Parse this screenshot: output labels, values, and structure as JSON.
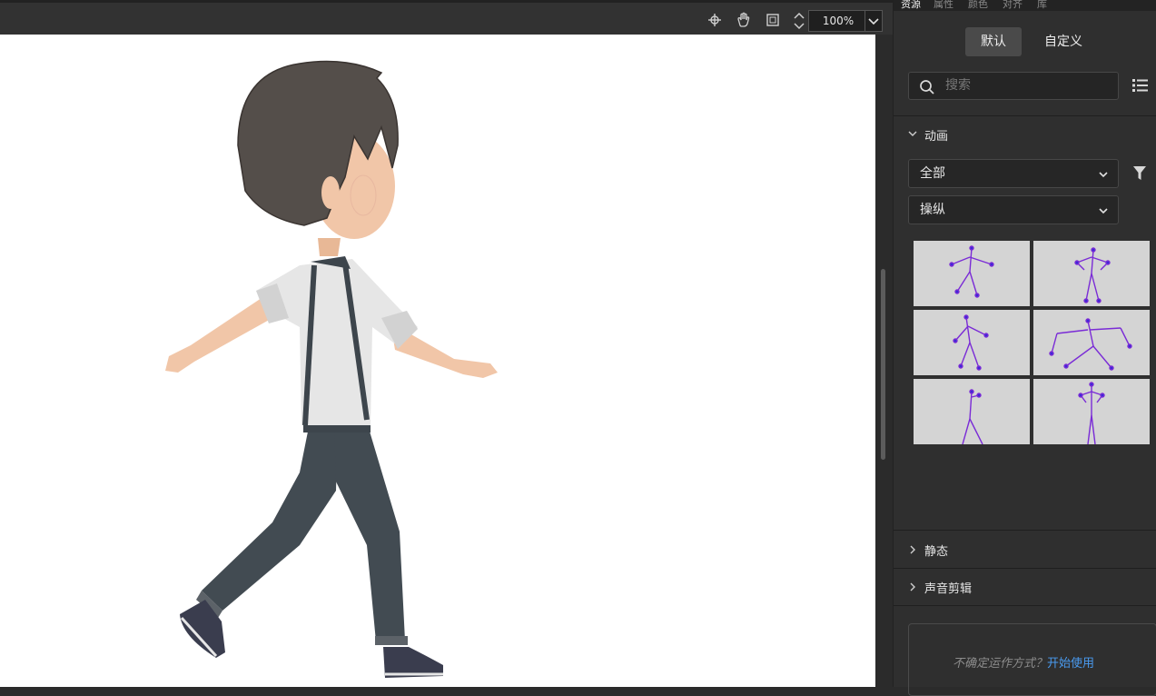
{
  "toolbar": {
    "icons": [
      "snap-icon",
      "hand-icon",
      "clip-icon"
    ],
    "zoom_value": "100%"
  },
  "panel": {
    "tabs": [
      "资源",
      "属性",
      "颜色",
      "对齐",
      "库"
    ],
    "segment": {
      "default_label": "默认",
      "custom_label": "自定义",
      "selected": "默认"
    },
    "search": {
      "placeholder": "搜索"
    },
    "sections": {
      "animation": {
        "title": "动画",
        "expanded": true
      },
      "static": {
        "title": "静态",
        "expanded": false
      },
      "sound": {
        "title": "声音剪辑",
        "expanded": false
      }
    },
    "filters": {
      "category_value": "全部",
      "type_value": "操纵"
    },
    "help": {
      "text": "不确定运作方式？",
      "link": "开始使用"
    }
  },
  "colors": {
    "link": "#4a9bf0",
    "rig_bones": "#7a2bd6",
    "stage_bg": "#ffffff",
    "panel_bg": "#2f2f2f"
  }
}
